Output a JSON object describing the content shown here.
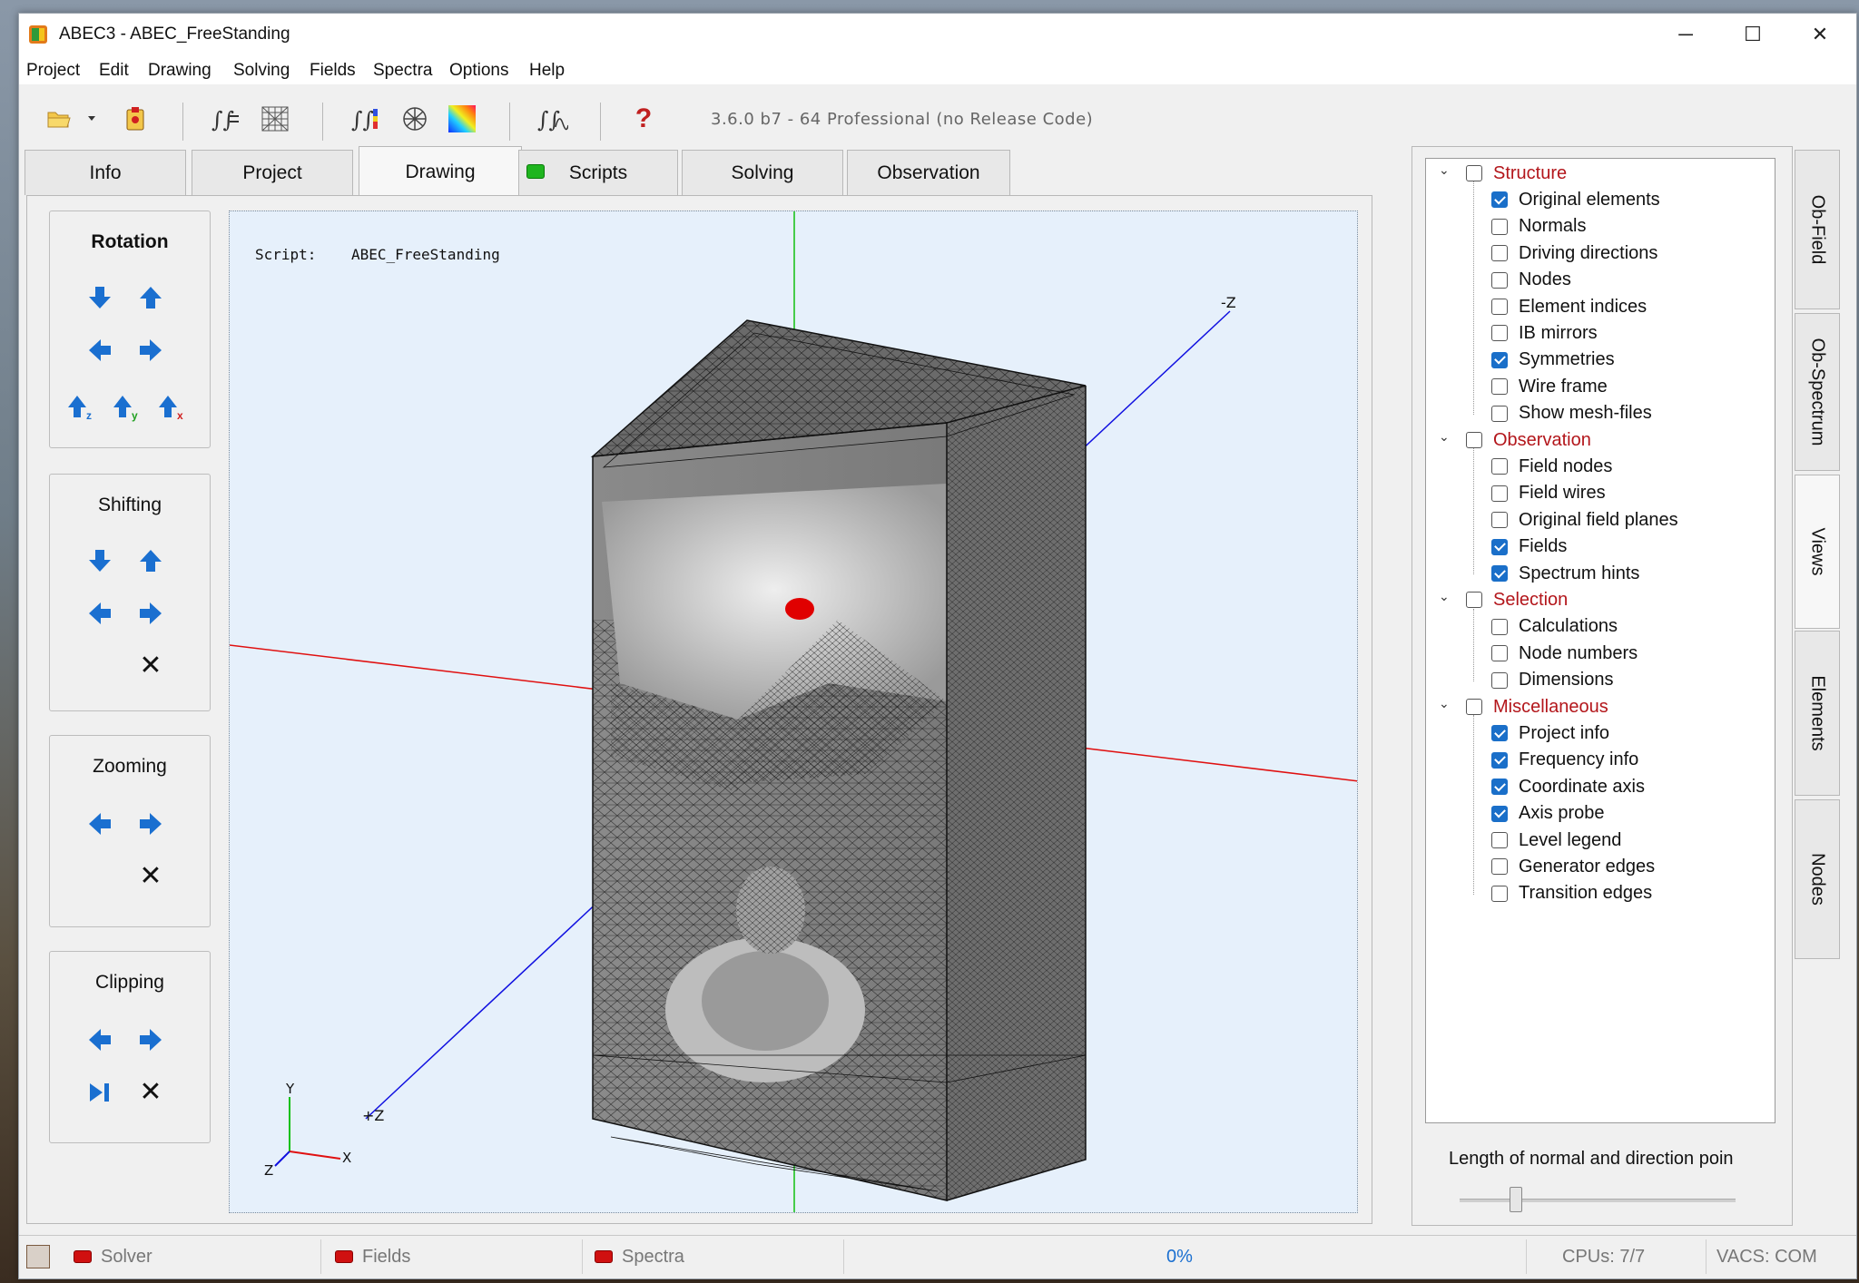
{
  "window": {
    "title": "ABEC3 - ABEC_FreeStanding",
    "controls": {
      "minimize": "─",
      "maximize": "☐",
      "close": "✕"
    }
  },
  "menu": [
    "Project",
    "Edit",
    "Drawing",
    "Solving",
    "Fields",
    "Spectra",
    "Options",
    "Help"
  ],
  "toolbar": {
    "version": "3.6.0 b7 - 64 Professional (no Release Code)",
    "icons": [
      "open-folder-icon",
      "dropdown-arrow-icon",
      "project-info-icon",
      "solve-equations-icon",
      "mesh-icon",
      "field-integrals-icon",
      "field-mesh-icon",
      "color-map-icon",
      "spectrum-icon",
      "help-icon"
    ],
    "help_glyph": "?"
  },
  "tabs": [
    {
      "label": "Info",
      "active": false
    },
    {
      "label": "Project",
      "active": false
    },
    {
      "label": "Drawing",
      "active": true
    },
    {
      "label": "Scripts",
      "active": false,
      "indicator": "#1fb51f"
    },
    {
      "label": "Solving",
      "active": false
    },
    {
      "label": "Observation",
      "active": false
    }
  ],
  "controls": {
    "rotation": {
      "title": "Rotation",
      "axis_labels": [
        "z",
        "y",
        "x"
      ]
    },
    "shifting": {
      "title": "Shifting"
    },
    "zooming": {
      "title": "Zooming"
    },
    "clipping": {
      "title": "Clipping"
    },
    "reset_glyph": "✕"
  },
  "viewport": {
    "script_label": "Script:",
    "script_name": "ABEC_FreeStanding",
    "axis_labels": {
      "neg_z": "-Z",
      "pos_z": "+Z"
    },
    "triad": {
      "x": "X",
      "y": "Y",
      "z": "Z"
    },
    "axis_colors": {
      "x": "#e01010",
      "y": "#10c010",
      "z": "#1010e0"
    },
    "probe_color": "#e00000"
  },
  "views_tree": [
    {
      "category": "Structure",
      "checked": false,
      "items": [
        {
          "label": "Original elements",
          "checked": true
        },
        {
          "label": "Normals",
          "checked": false
        },
        {
          "label": "Driving directions",
          "checked": false
        },
        {
          "label": "Nodes",
          "checked": false
        },
        {
          "label": "Element indices",
          "checked": false
        },
        {
          "label": "IB mirrors",
          "checked": false
        },
        {
          "label": "Symmetries",
          "checked": true
        },
        {
          "label": "Wire frame",
          "checked": false
        },
        {
          "label": "Show mesh-files",
          "checked": false
        }
      ]
    },
    {
      "category": "Observation",
      "checked": false,
      "items": [
        {
          "label": "Field nodes",
          "checked": false
        },
        {
          "label": "Field wires",
          "checked": false
        },
        {
          "label": "Original field planes",
          "checked": false
        },
        {
          "label": "Fields",
          "checked": true
        },
        {
          "label": "Spectrum hints",
          "checked": true
        }
      ]
    },
    {
      "category": "Selection",
      "checked": false,
      "items": [
        {
          "label": "Calculations",
          "checked": false
        },
        {
          "label": "Node numbers",
          "checked": false
        },
        {
          "label": "Dimensions",
          "checked": false
        }
      ]
    },
    {
      "category": "Miscellaneous",
      "checked": false,
      "items": [
        {
          "label": "Project info",
          "checked": true
        },
        {
          "label": "Frequency info",
          "checked": true
        },
        {
          "label": "Coordinate axis",
          "checked": true
        },
        {
          "label": "Axis probe",
          "checked": true
        },
        {
          "label": "Level legend",
          "checked": false
        },
        {
          "label": "Generator edges",
          "checked": false
        },
        {
          "label": "Transition edges",
          "checked": false
        }
      ]
    }
  ],
  "length_label": "Length of normal and direction poin",
  "length_slider": {
    "value": 0.19
  },
  "side_tabs": [
    {
      "label": "Ob-Field",
      "active": false
    },
    {
      "label": "Ob-Spectrum",
      "active": false
    },
    {
      "label": "Views",
      "active": true
    },
    {
      "label": "Elements",
      "active": false
    },
    {
      "label": "Nodes",
      "active": false
    }
  ],
  "status": {
    "solver": "Solver",
    "fields": "Fields",
    "spectra": "Spectra",
    "progress": "0%",
    "cpus": "CPUs: 7/7",
    "vacs": "VACS: COM"
  }
}
